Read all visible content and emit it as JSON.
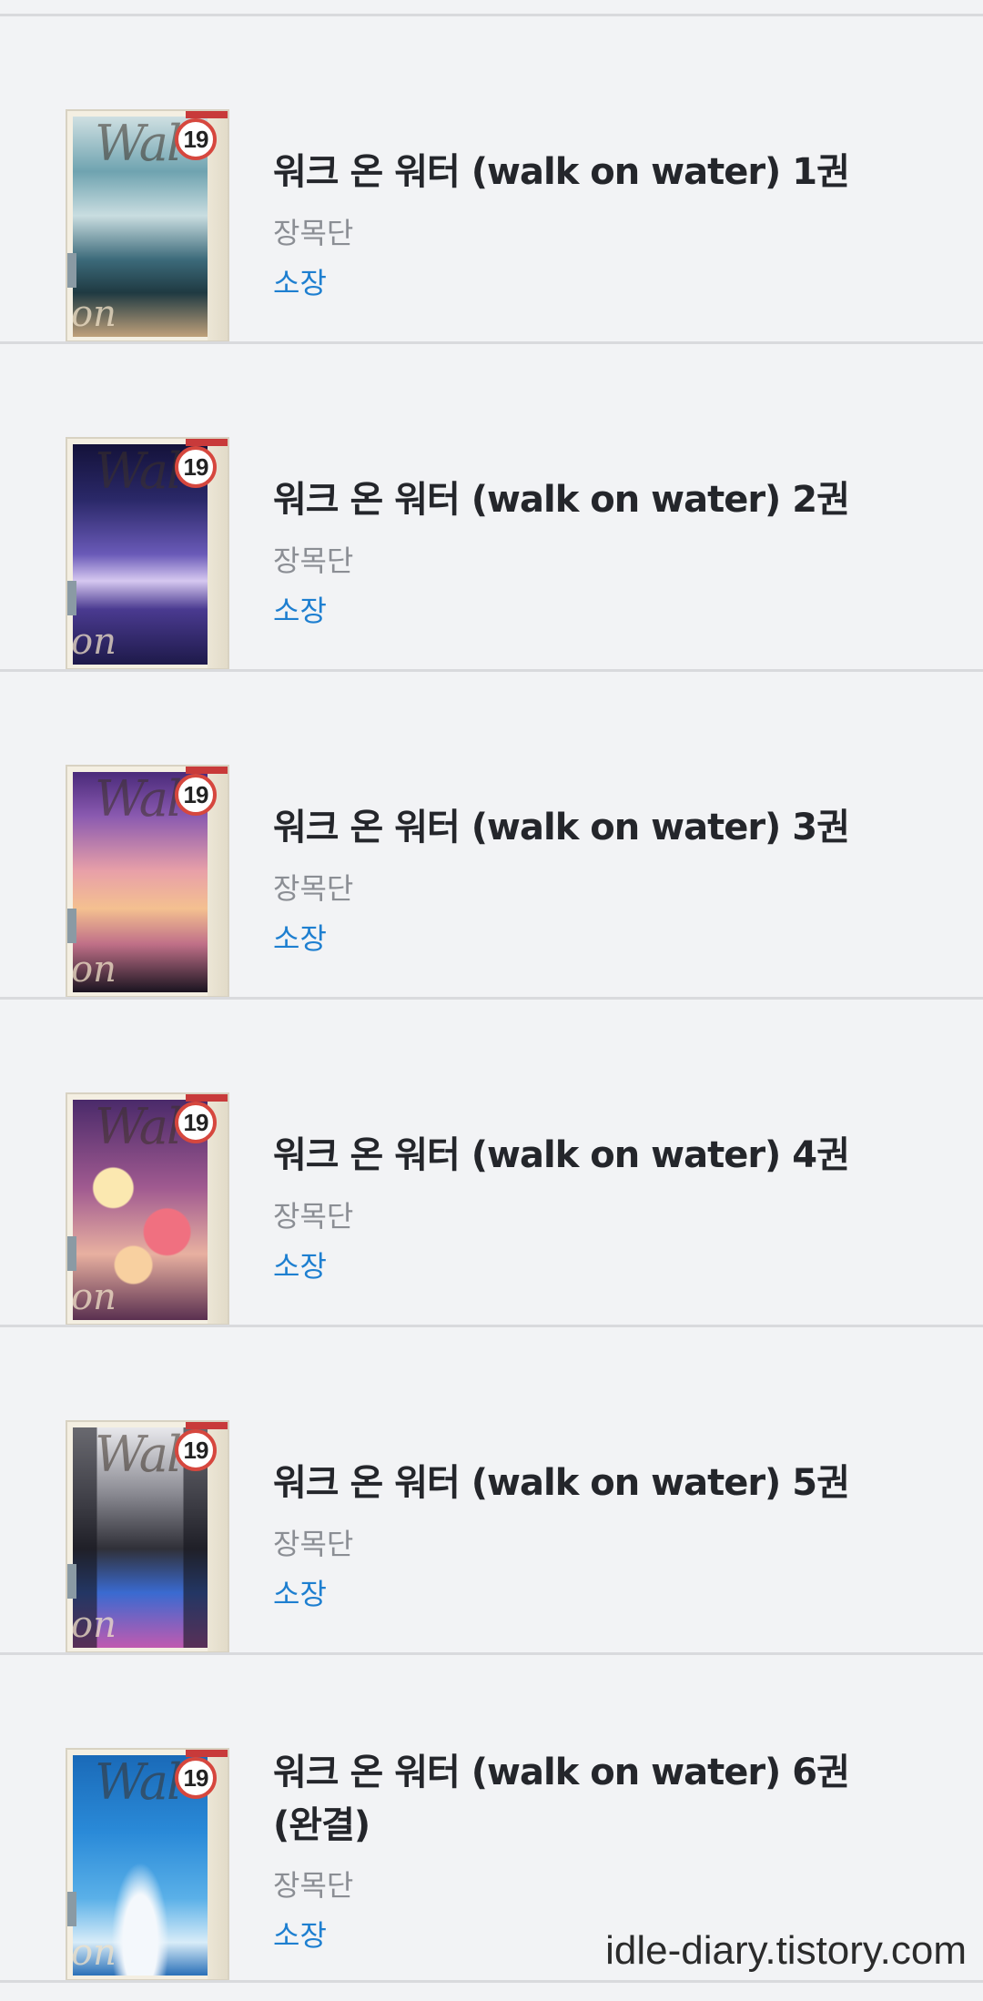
{
  "books": [
    {
      "title": "워크 온 워터 (walk on water) 1권",
      "author": "장목단",
      "status": "소장",
      "badge": "19",
      "cover_script_top": "Wal",
      "cover_script_bottom": "on water",
      "cover_colors": [
        "#3c6a7a",
        "#8fb6c4",
        "#2c4a55"
      ]
    },
    {
      "title": "워크 온 워터 (walk on water) 2권",
      "author": "장목단",
      "status": "소장",
      "badge": "19",
      "cover_script_top": "Wal",
      "cover_script_bottom": "on water",
      "cover_colors": [
        "#1e1a4a",
        "#6a5ab8",
        "#d6c8f0"
      ]
    },
    {
      "title": "워크 온 워터 (walk on water) 3권",
      "author": "장목단",
      "status": "소장",
      "badge": "19",
      "cover_script_top": "Wal",
      "cover_script_bottom": "on water",
      "cover_colors": [
        "#5a3a8a",
        "#e8a0a8",
        "#f4c090"
      ]
    },
    {
      "title": "워크 온 워터 (walk on water) 4권",
      "author": "장목단",
      "status": "소장",
      "badge": "19",
      "cover_script_top": "Wal",
      "cover_script_bottom": "on water",
      "cover_colors": [
        "#6a3a7a",
        "#f0d0a0",
        "#e06070"
      ]
    },
    {
      "title": "워크 온 워터 (walk on water) 5권",
      "author": "장목단",
      "status": "소장",
      "badge": "19",
      "cover_script_top": "Wal",
      "cover_script_bottom": "on water",
      "cover_colors": [
        "#202028",
        "#8a8a92",
        "#3a6ad0"
      ]
    },
    {
      "title": "워크 온 워터 (walk on water) 6권 (완결)",
      "author": "장목단",
      "status": "소장",
      "badge": "19",
      "cover_script_top": "Wal",
      "cover_script_bottom": "on water",
      "cover_colors": [
        "#1a78c8",
        "#5ab0e8",
        "#d8ecf8"
      ]
    }
  ],
  "watermark": "idle-diary.tistory.com"
}
